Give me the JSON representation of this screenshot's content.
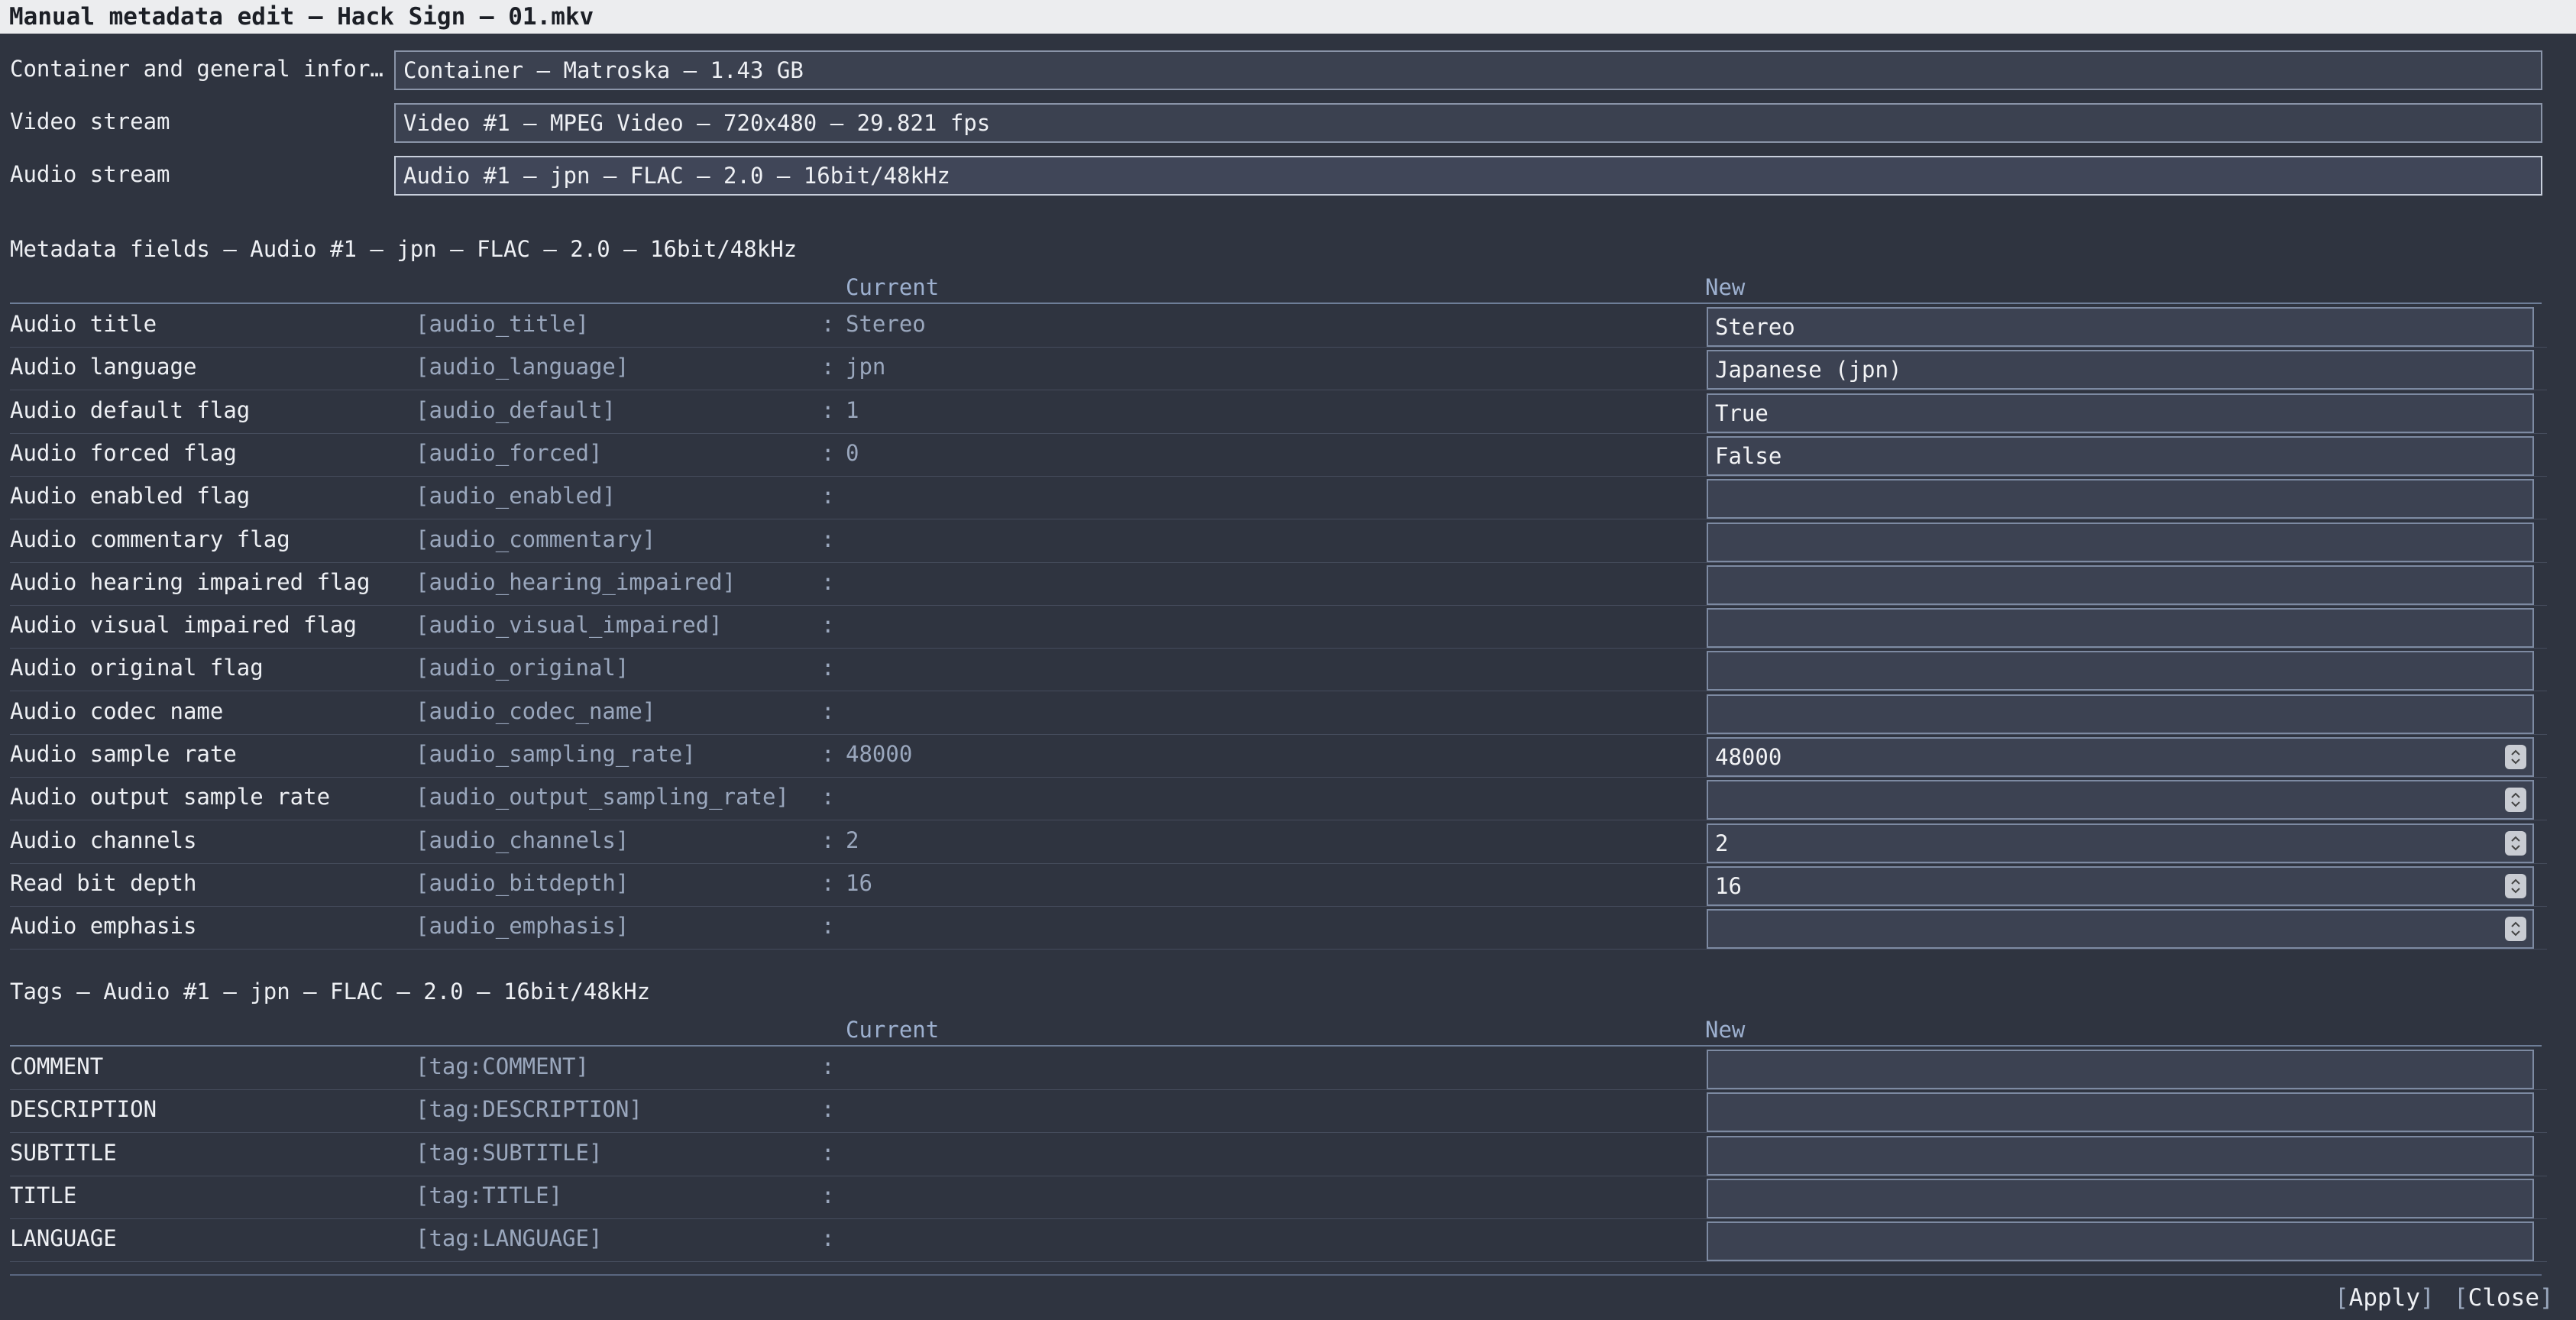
{
  "window": {
    "title": "Manual metadata edit – Hack Sign – 01.mkv"
  },
  "streams": [
    {
      "label": "Container and general infor…",
      "value": "Container – Matroska – 1.43 GB"
    },
    {
      "label": "Video stream",
      "value": "Video #1 – MPEG Video – 720x480 – 29.821 fps"
    },
    {
      "label": "Audio stream",
      "value": "Audio #1 – jpn – FLAC – 2.0 – 16bit/48kHz"
    }
  ],
  "metadata": {
    "title": "Metadata fields – Audio #1 – jpn – FLAC – 2.0 – 16bit/48kHz",
    "current_header": "Current",
    "new_header": "New",
    "rows": [
      {
        "label": "Audio title",
        "key": "[audio_title]",
        "current": "Stereo",
        "new": "Stereo",
        "spinner": false
      },
      {
        "label": "Audio language",
        "key": "[audio_language]",
        "current": "jpn",
        "new": "Japanese (jpn)",
        "spinner": false
      },
      {
        "label": "Audio default flag",
        "key": "[audio_default]",
        "current": "1",
        "new": "True",
        "spinner": false
      },
      {
        "label": "Audio forced flag",
        "key": "[audio_forced]",
        "current": "0",
        "new": "False",
        "spinner": false
      },
      {
        "label": "Audio enabled flag",
        "key": "[audio_enabled]",
        "current": "",
        "new": "",
        "spinner": false
      },
      {
        "label": "Audio commentary flag",
        "key": "[audio_commentary]",
        "current": "",
        "new": "",
        "spinner": false
      },
      {
        "label": "Audio hearing impaired flag",
        "key": "[audio_hearing_impaired]",
        "current": "",
        "new": "",
        "spinner": false
      },
      {
        "label": "Audio visual impaired flag",
        "key": "[audio_visual_impaired]",
        "current": "",
        "new": "",
        "spinner": false
      },
      {
        "label": "Audio original flag",
        "key": "[audio_original]",
        "current": "",
        "new": "",
        "spinner": false
      },
      {
        "label": "Audio codec name",
        "key": "[audio_codec_name]",
        "current": "",
        "new": "",
        "spinner": false
      },
      {
        "label": "Audio sample rate",
        "key": "[audio_sampling_rate]",
        "current": "48000",
        "new": "48000",
        "spinner": true
      },
      {
        "label": "Audio output sample rate",
        "key": "[audio_output_sampling_rate]",
        "current": "",
        "new": "",
        "spinner": true
      },
      {
        "label": "Audio channels",
        "key": "[audio_channels]",
        "current": "2",
        "new": "2",
        "spinner": true
      },
      {
        "label": "Read bit depth",
        "key": "[audio_bitdepth]",
        "current": "16",
        "new": "16",
        "spinner": true
      },
      {
        "label": "Audio emphasis",
        "key": "[audio_emphasis]",
        "current": "",
        "new": "",
        "spinner": true
      }
    ]
  },
  "tags": {
    "title": "Tags – Audio #1 – jpn – FLAC – 2.0 – 16bit/48kHz",
    "current_header": "Current",
    "new_header": "New",
    "rows": [
      {
        "label": "COMMENT",
        "key": "[tag:COMMENT]",
        "current": "",
        "new": ""
      },
      {
        "label": "DESCRIPTION",
        "key": "[tag:DESCRIPTION]",
        "current": "",
        "new": ""
      },
      {
        "label": "SUBTITLE",
        "key": "[tag:SUBTITLE]",
        "current": "",
        "new": ""
      },
      {
        "label": "TITLE",
        "key": "[tag:TITLE]",
        "current": "",
        "new": ""
      },
      {
        "label": "LANGUAGE",
        "key": "[tag:LANGUAGE]",
        "current": "",
        "new": ""
      }
    ]
  },
  "buttons": {
    "apply": "Apply",
    "close": "Close",
    "bracket_open": "[",
    "bracket_close": "]"
  },
  "colon": ":"
}
